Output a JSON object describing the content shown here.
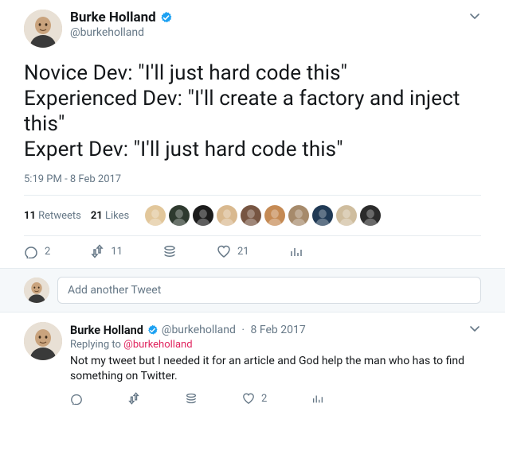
{
  "main": {
    "author": {
      "display_name": "Burke Holland",
      "handle": "@burkeholland",
      "verified": true
    },
    "text": "Novice Dev: \"I'll just hard code this\"\nExperienced Dev: \"I'll create a factory and inject this\"\nExpert Dev: \"I'll just hard code this\"",
    "timestamp": "5:19 PM - 8 Feb 2017",
    "stats": {
      "retweets_count": "11",
      "retweets_label": "Retweets",
      "likes_count": "21",
      "likes_label": "Likes"
    },
    "liker_colors": [
      "#e2c79b",
      "#2e3a2f",
      "#1b1b1b",
      "#d9b98f",
      "#775542",
      "#c58a54",
      "#a68a6b",
      "#203a55",
      "#cfbd9e",
      "#2b2b2b"
    ],
    "actions": {
      "reply_count": "2",
      "retweet_count": "11",
      "like_count": "21"
    }
  },
  "compose": {
    "placeholder": "Add another Tweet"
  },
  "reply": {
    "author": {
      "display_name": "Burke Holland",
      "handle": "@burkeholland",
      "verified": true
    },
    "date": "8 Feb 2017",
    "replying_prefix": "Replying to ",
    "replying_mention": "@burkeholland",
    "text": "Not my tweet but I needed it for an article and God help the man who has to find something on Twitter.",
    "like_count": "2"
  }
}
